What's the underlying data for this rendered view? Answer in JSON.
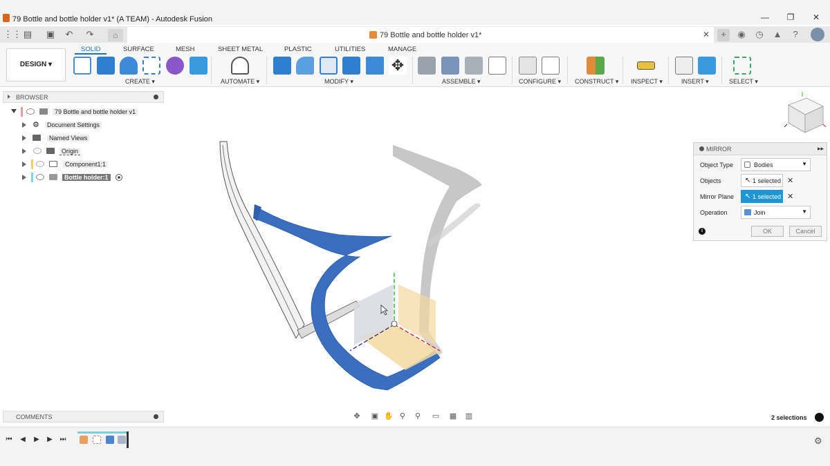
{
  "window": {
    "title": "79 Bottle and bottle holder v1* (A TEAM) - Autodesk Fusion",
    "minimize": "—",
    "maximize": "❐",
    "close": "✕"
  },
  "doc_tab": {
    "title": "79 Bottle and bottle holder v1*",
    "close": "✕"
  },
  "workspace": {
    "label": "DESIGN ▾"
  },
  "ribbon_tabs": [
    "SOLID",
    "SURFACE",
    "MESH",
    "SHEET METAL",
    "PLASTIC",
    "UTILITIES",
    "MANAGE"
  ],
  "ribbon_groups": [
    "CREATE ▾",
    "AUTOMATE ▾",
    "MODIFY ▾",
    "ASSEMBLE ▾",
    "CONFIGURE ▾",
    "CONSTRUCT ▾",
    "INSPECT ▾",
    "INSERT ▾",
    "SELECT ▾"
  ],
  "browser": {
    "title": "BROWSER",
    "items": [
      {
        "label": "79 Bottle and bottle holder v1"
      },
      {
        "label": "Document Settings"
      },
      {
        "label": "Named Views"
      },
      {
        "label": "Origin"
      },
      {
        "label": "Component1:1"
      },
      {
        "label": "Bottle holder:1"
      }
    ]
  },
  "mirror": {
    "title": "MIRROR",
    "object_type_label": "Object Type",
    "object_type_value": "Bodies",
    "objects_label": "Objects",
    "objects_value": "1 selected",
    "plane_label": "Mirror Plane",
    "plane_value": "1 selected",
    "operation_label": "Operation",
    "operation_value": "Join",
    "ok": "OK",
    "cancel": "Cancel"
  },
  "comments": {
    "title": "COMMENTS"
  },
  "status": {
    "selections": "2 selections"
  },
  "colors": {
    "accent": "#1a73c4",
    "selected_body": "#3a6fc0",
    "mirror_plane_active": "#1e96d6"
  }
}
